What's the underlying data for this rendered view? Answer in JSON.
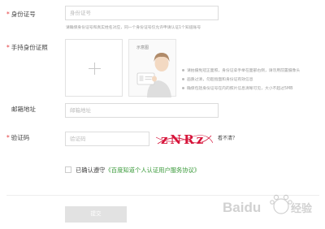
{
  "form": {
    "id_number": {
      "label": "身份证号",
      "placeholder": "身份证号",
      "hint": "请确保身份证号和真实姓名对应，同一个身份证号仅允许申请认证1个知道账号"
    },
    "id_photo": {
      "label": "手持身份证照",
      "sample_label": "示意图",
      "requirements": [
        "请拍摄免冠正面照，身份证拿手举在面部右侧，请勿用前置摄像头",
        "画质过清，勿超指面和身份证有效信息",
        "确保包括身份证号在内的照片信息清晰可见，大小不超过5MB"
      ]
    },
    "email": {
      "label": "邮箱地址",
      "placeholder": "邮箱地址"
    },
    "captcha": {
      "label": "验证码",
      "placeholder": "验证码",
      "code": "zNRz",
      "refresh_label": "看不清？"
    },
    "agreement": {
      "prefix": "已确认遵守",
      "link": "《百度知道个人认证用户服务协议》"
    },
    "submit_label": "提交"
  },
  "required_marker": "*",
  "watermark": {
    "brand": "Baidu",
    "suffix": "经验"
  },
  "colors": {
    "required": "#e4393c",
    "link": "#3a9a3a",
    "captcha": "#d6143a",
    "submit_bg": "#e2e2e2"
  }
}
